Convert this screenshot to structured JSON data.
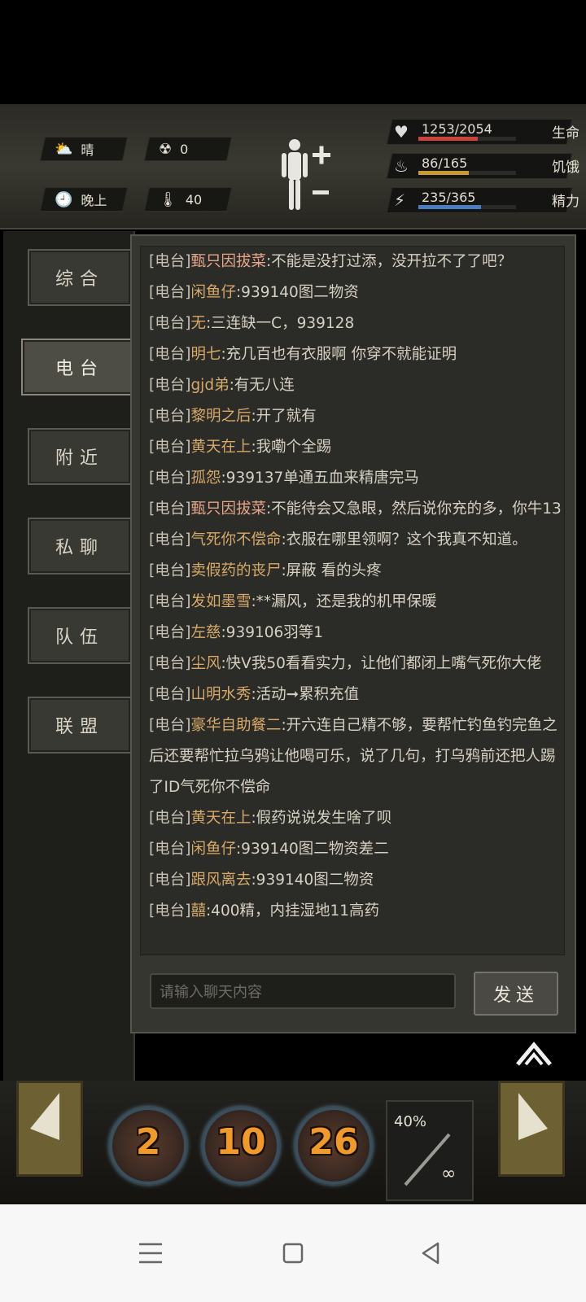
{
  "status": {
    "weather": "晴",
    "radiation": "0",
    "time_of_day": "晚上",
    "temperature": "40",
    "stats": [
      {
        "name": "生命",
        "value": "1253/2054",
        "fill": 0.61,
        "color": "#c9443a",
        "icon": "heart-icon"
      },
      {
        "name": "饥饿",
        "value": "86/165",
        "fill": 0.52,
        "color": "#c89a36",
        "icon": "stomach-icon"
      },
      {
        "name": "精力",
        "value": "235/365",
        "fill": 0.64,
        "color": "#4a7ec0",
        "icon": "energy-icon"
      }
    ]
  },
  "tabs": [
    "综合",
    "电台",
    "附近",
    "私聊",
    "队伍",
    "联盟"
  ],
  "active_tab": "电台",
  "chat": {
    "channel_tag": "[电台]",
    "messages": [
      {
        "nick": "甄只因拔菜",
        "text": ":不能是没打过添，没开拉不了了吧？"
      },
      {
        "nick": "闲鱼仔",
        "text": ":939140图二物资"
      },
      {
        "nick": "无",
        "text": ":三连缺一C，939128"
      },
      {
        "nick": "明七",
        "text": ":充几百也有衣服啊 你穿不就能证明"
      },
      {
        "nick": "gjd弟",
        "text": ":有无八连"
      },
      {
        "nick": "黎明之后",
        "text": ":开了就有"
      },
      {
        "nick": "黄天在上",
        "text": ":我嘞个全踢"
      },
      {
        "nick": "孤怨",
        "text": ":939137单通五血来精唐完马"
      },
      {
        "nick": "甄只因拔菜",
        "text": ":不能待会又急眼，然后说你充的多，你牛13"
      },
      {
        "nick": "气死你不偿命",
        "text": ":衣服在哪里领啊？这个我真不知道。"
      },
      {
        "nick": "卖假药的丧尸",
        "text": ":屏蔽 看的头疼"
      },
      {
        "nick": "发如墨雪",
        "text": ":**漏风，还是我的机甲保暖"
      },
      {
        "nick": "左慈",
        "text": ":939106羽等1"
      },
      {
        "nick": "尘风",
        "text": ":快V我50看看实力，让他们都闭上嘴气死你大佬"
      },
      {
        "nick": "山明水秀",
        "text": ":活动➞累积充值"
      },
      {
        "nick": "豪华自助餐二",
        "text": ":开六连自己精不够，要帮忙钓鱼钓完鱼之后还要帮忙拉乌鸦让他喝可乐，说了几句，打乌鸦前还把人踢了ID气死你不偿命"
      },
      {
        "nick": "黄天在上",
        "text": ":假药说说发生啥了呗"
      },
      {
        "nick": "闲鱼仔",
        "text": ":939140图二物资差二"
      },
      {
        "nick": "跟风离去",
        "text": ":939140图二物资"
      },
      {
        "nick": "囍",
        "text": ":400精，内挂湿地11高药"
      }
    ],
    "input_placeholder": "请输入聊天内容",
    "send_label": "发送"
  },
  "action_bar": {
    "skills": [
      "2",
      "10",
      "26"
    ],
    "weapon_durability": "40%",
    "weapon_ammo": "∞"
  },
  "colors": {
    "accent": "#d7a96a",
    "panel": "#363631",
    "skill_number": "#f09a2e"
  }
}
